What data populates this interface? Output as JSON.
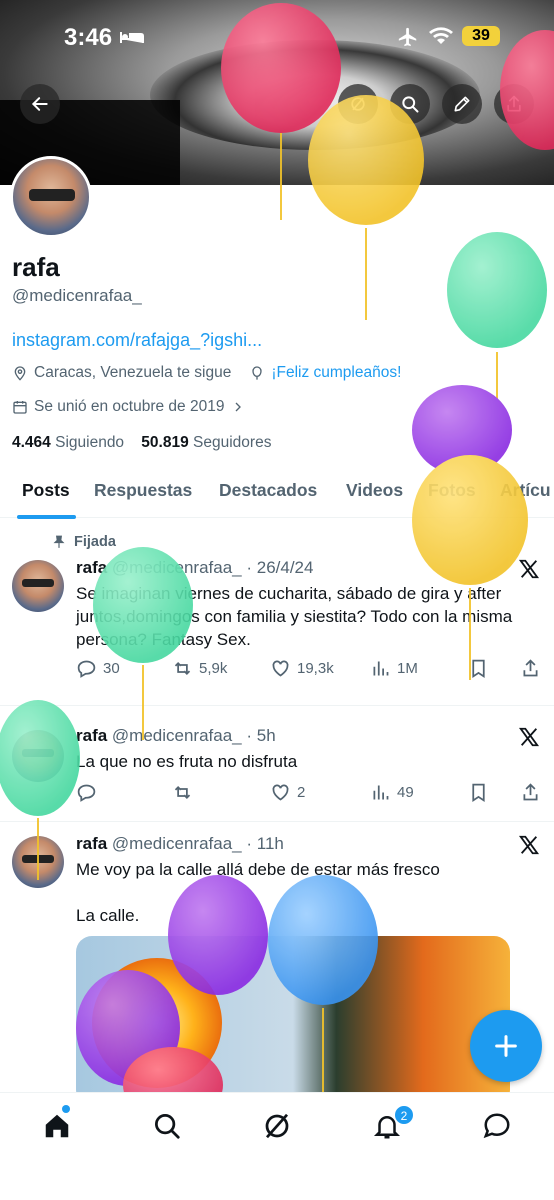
{
  "status_bar": {
    "time": "3:46",
    "battery": "39"
  },
  "profile": {
    "name": "rafa",
    "handle": "@medicenrafaa_",
    "link": "instagram.com/rafajga_?igshi...",
    "location": "Caracas, Venezuela te sigue",
    "birthday": "¡Feliz cumpleaños!",
    "joined": "Se unió en octubre de 2019",
    "following_count": "4.464",
    "following_label": "Siguiendo",
    "followers_count": "50.819",
    "followers_label": "Seguidores"
  },
  "tabs": [
    "Posts",
    "Respuestas",
    "Destacados",
    "Videos",
    "Fotos",
    "Artícu"
  ],
  "posts": [
    {
      "pinned_label": "Fijada",
      "name": "rafa",
      "meta": "@medicenrafaa_ · 26/4/24",
      "text": "Se imaginan viernes de cucharita, sábado de gira y after juntos,domingos con familia y siestita? Todo con la misma persona? Fantasy Sex.",
      "replies": "30",
      "reposts": "5,9k",
      "likes": "19,3k",
      "views": "1M"
    },
    {
      "name": "rafa",
      "meta": "@medicenrafaa_ · 5h",
      "text": "La que no es fruta no disfruta",
      "replies": "",
      "reposts": "",
      "likes": "2",
      "views": "49"
    },
    {
      "name": "rafa",
      "meta": "@medicenrafaa_ · 11h",
      "text": "Me voy pa la calle allá debe de estar más fresco",
      "text2": "La calle."
    }
  ],
  "colors": {
    "accent": "#1d9bf0",
    "text": "#0f1419",
    "muted": "#536471"
  },
  "notifications_badge": "2"
}
